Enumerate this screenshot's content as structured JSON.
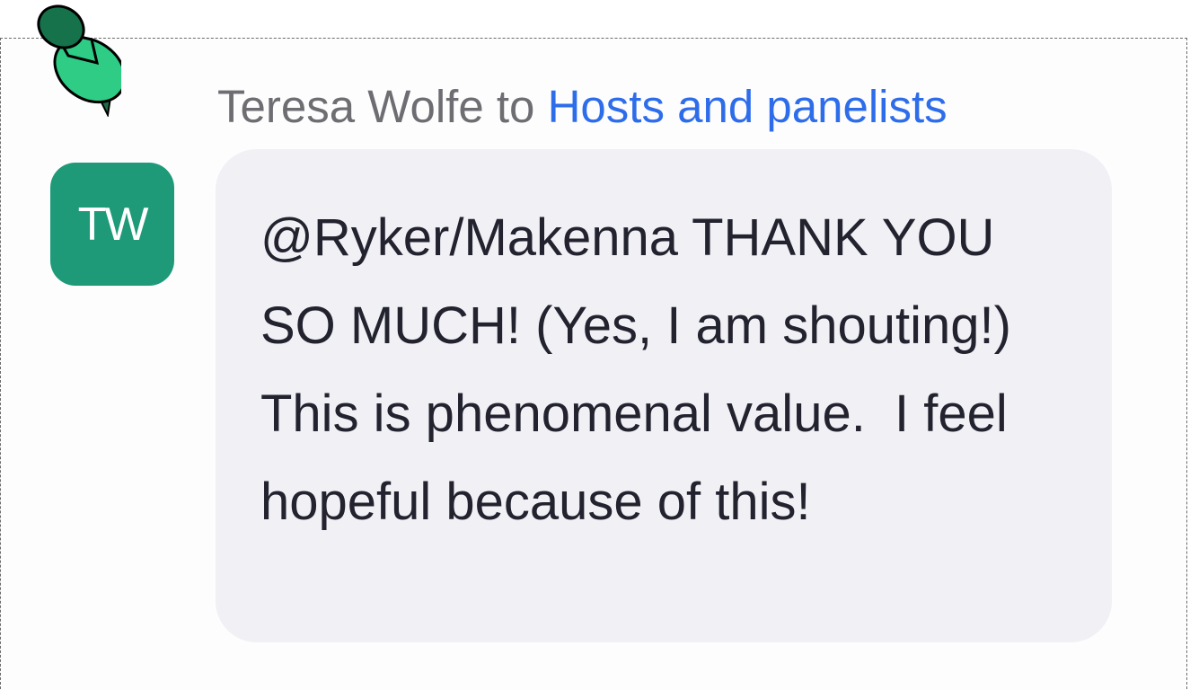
{
  "chat_message": {
    "sender": "Teresa Wolfe",
    "separator": "to",
    "recipients": "Hosts and panelists",
    "avatar_initials": "TW",
    "text": "@Ryker/Makenna THANK YOU SO MUCH! (Yes, I am shouting!)  This is phenomenal value.  I feel hopeful because of this!"
  },
  "colors": {
    "avatar": "#1e9a78",
    "recipients": "#2e6dea",
    "bubble": "#f0f0f5",
    "pin": "#2ecc85"
  },
  "icons": {
    "pin": "push-pin-icon"
  }
}
